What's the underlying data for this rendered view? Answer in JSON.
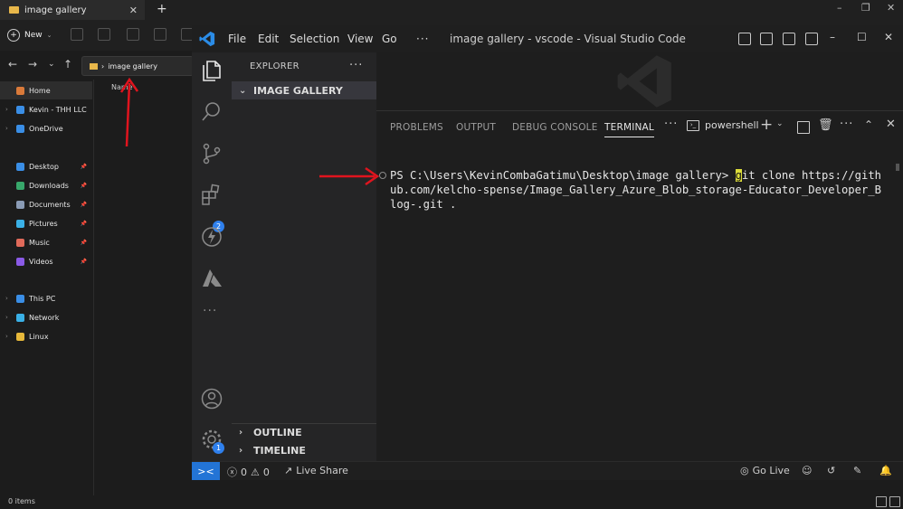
{
  "file_explorer": {
    "tab_title": "image gallery",
    "new_label": "New",
    "address_path": "image gallery",
    "column_name": "Name",
    "status_items": "0 items",
    "sidebar": [
      {
        "label": "Home",
        "icon": "home-icon",
        "expandable": false,
        "pinned": false
      },
      {
        "label": "Kevin - THH LLC",
        "icon": "cloud-icon",
        "expandable": true,
        "pinned": false
      },
      {
        "label": "OneDrive",
        "icon": "cloud-icon",
        "expandable": true,
        "pinned": false
      },
      {
        "label": "Desktop",
        "icon": "desktop-icon",
        "expandable": false,
        "pinned": true
      },
      {
        "label": "Downloads",
        "icon": "download-icon",
        "expandable": false,
        "pinned": true
      },
      {
        "label": "Documents",
        "icon": "document-icon",
        "expandable": false,
        "pinned": true
      },
      {
        "label": "Pictures",
        "icon": "pictures-icon",
        "expandable": false,
        "pinned": true
      },
      {
        "label": "Music",
        "icon": "music-icon",
        "expandable": false,
        "pinned": true
      },
      {
        "label": "Videos",
        "icon": "videos-icon",
        "expandable": false,
        "pinned": true
      },
      {
        "label": "This PC",
        "icon": "pc-icon",
        "expandable": true,
        "pinned": false
      },
      {
        "label": "Network",
        "icon": "network-icon",
        "expandable": true,
        "pinned": false
      },
      {
        "label": "Linux",
        "icon": "linux-icon",
        "expandable": true,
        "pinned": false
      }
    ]
  },
  "vscode": {
    "menu": [
      "File",
      "Edit",
      "Selection",
      "View",
      "Go"
    ],
    "menu_more": "···",
    "window_title": "image gallery - vscode - Visual Studio Code",
    "explorer_title": "EXPLORER",
    "explorer_more": "···",
    "folder_section": "IMAGE GALLERY",
    "outline_section": "OUTLINE",
    "timeline_section": "TIMELINE",
    "extensions_badge": "2",
    "settings_badge": "1",
    "panel_tabs": [
      "PROBLEMS",
      "OUTPUT",
      "DEBUG CONSOLE",
      "TERMINAL"
    ],
    "panel_more": "···",
    "terminal_shell": "powershell",
    "terminal": {
      "prompt": "PS C:\\Users\\KevinCombaGatimu\\Desktop\\image gallery> ",
      "cursor_char": "g",
      "line1_rest": "it clone https://gith",
      "line2": "ub.com/kelcho-spense/Image_Gallery_Azure_Blob_storage-Educator_Developer_B",
      "line3": "log-.git ."
    },
    "status": {
      "errors": "0",
      "warnings": "0",
      "live_share": "Live Share",
      "go_live": "Go Live"
    }
  },
  "colors": {
    "accent": "#2374d6",
    "annotation_arrow": "#e0141e",
    "folder": "#e8b74a"
  }
}
